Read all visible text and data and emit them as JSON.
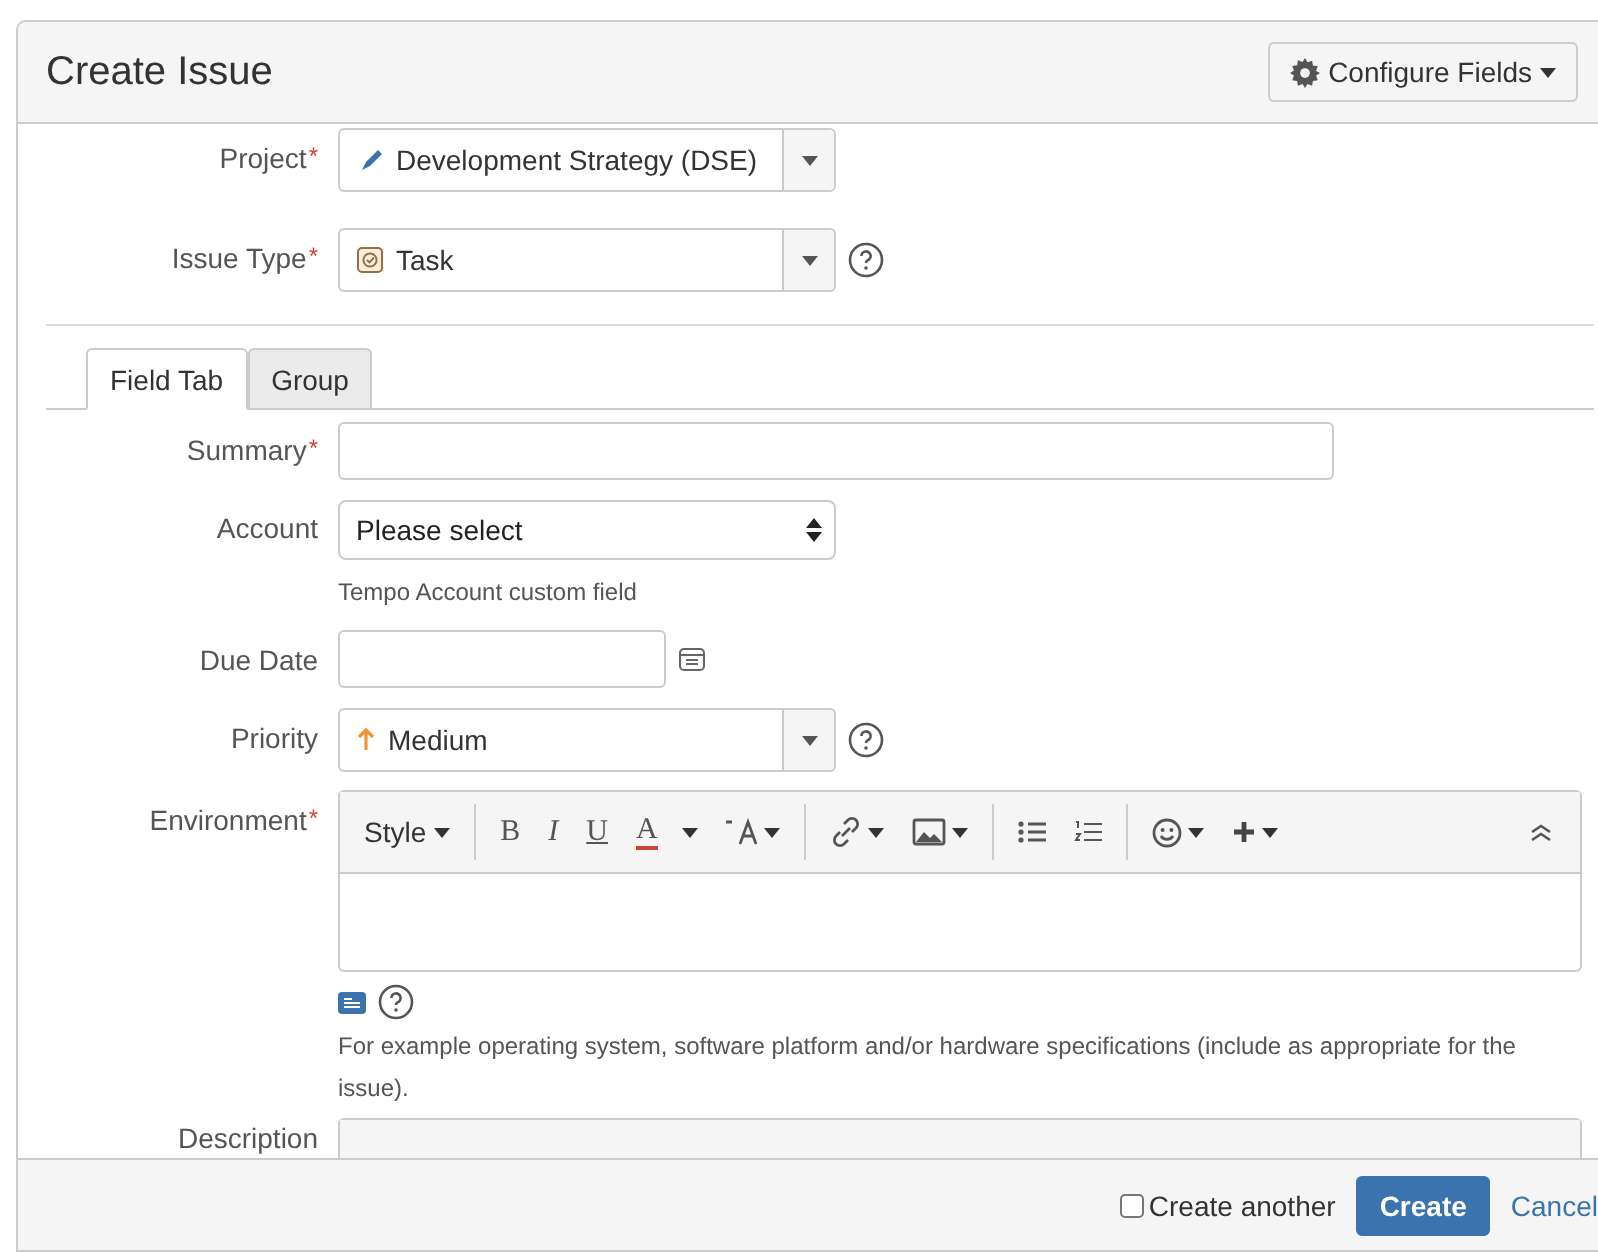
{
  "dialog": {
    "title": "Create Issue",
    "configure_button": "Configure Fields"
  },
  "top_fields": [
    {
      "label": "Project",
      "required_mark": "*",
      "kind": "select",
      "value": "Development Strategy (DSE)",
      "help": false
    },
    {
      "label": "Issue Type",
      "required_mark": "*",
      "kind": "select",
      "value": "Task",
      "help": true
    }
  ],
  "tabs": [
    {
      "label": "Field Tab",
      "selected": true
    },
    {
      "label": "Group",
      "selected": false
    }
  ],
  "fields": [
    {
      "label": "Summary",
      "required_mark": "*",
      "kind": "text",
      "help": false
    },
    {
      "label": "Account",
      "kind": "native-select",
      "value": "Please select",
      "hint": "Tempo Account custom field",
      "help": false
    },
    {
      "label": "Due Date",
      "kind": "date",
      "help": false
    },
    {
      "label": "Priority",
      "kind": "select",
      "value": "Medium",
      "help": true
    },
    {
      "label": "Environment",
      "required_mark": "*",
      "kind": "editor",
      "hint": "For example operating system, software platform and/or hardware specifications (include as appropriate for the issue).",
      "help": true
    },
    {
      "label": "Description",
      "kind": "editor-cut",
      "help": false
    }
  ],
  "editor_toolbar": [
    {
      "kind": "style",
      "text": "Style"
    },
    {
      "kind": "sep"
    },
    {
      "kind": "bold",
      "text": "B"
    },
    {
      "kind": "italic",
      "text": "I"
    },
    {
      "kind": "underline",
      "text": "U"
    },
    {
      "kind": "color",
      "text": "A"
    },
    {
      "kind": "caret"
    },
    {
      "kind": "format"
    },
    {
      "kind": "sep"
    },
    {
      "kind": "link"
    },
    {
      "kind": "image"
    },
    {
      "kind": "sep"
    },
    {
      "kind": "bullets"
    },
    {
      "kind": "numbers"
    },
    {
      "kind": "sep"
    },
    {
      "kind": "emoji"
    },
    {
      "kind": "plus"
    }
  ],
  "footer": {
    "create_another": {
      "label": "Create another",
      "checked": false
    },
    "create_button": "Create",
    "cancel_link": "Cancel"
  }
}
